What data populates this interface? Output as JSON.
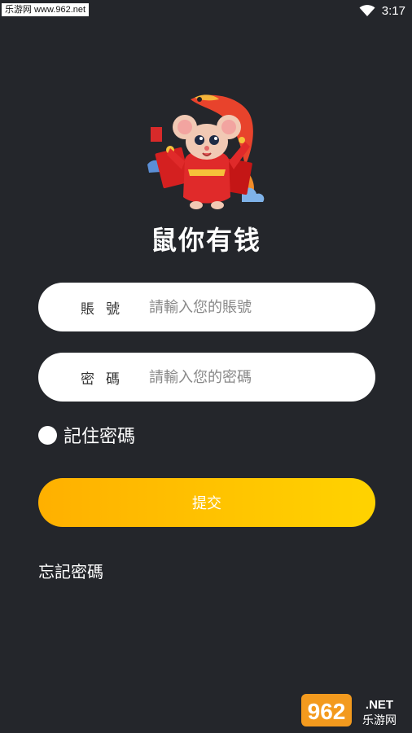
{
  "status_bar": {
    "watermark": "乐游网 www.962.net",
    "time": "3:17",
    "icons": [
      "wifi-icon"
    ]
  },
  "app": {
    "title": "鼠你有钱",
    "logo_icon": "mouse-new-year-logo"
  },
  "form": {
    "account": {
      "label": "賬號",
      "placeholder": "請輸入您的賬號",
      "value": ""
    },
    "password": {
      "label": "密碼",
      "placeholder": "請輸入您的密碼",
      "value": ""
    },
    "remember_label": "記住密碼",
    "remember_checked": false,
    "submit_label": "提交",
    "forgot_label": "忘記密碼"
  },
  "watermark_bottom": {
    "number": "962",
    "suffix": ".NET",
    "text": "乐游网"
  },
  "colors": {
    "background": "#24262b",
    "accent_start": "#ffb000",
    "accent_end": "#ffd300"
  }
}
